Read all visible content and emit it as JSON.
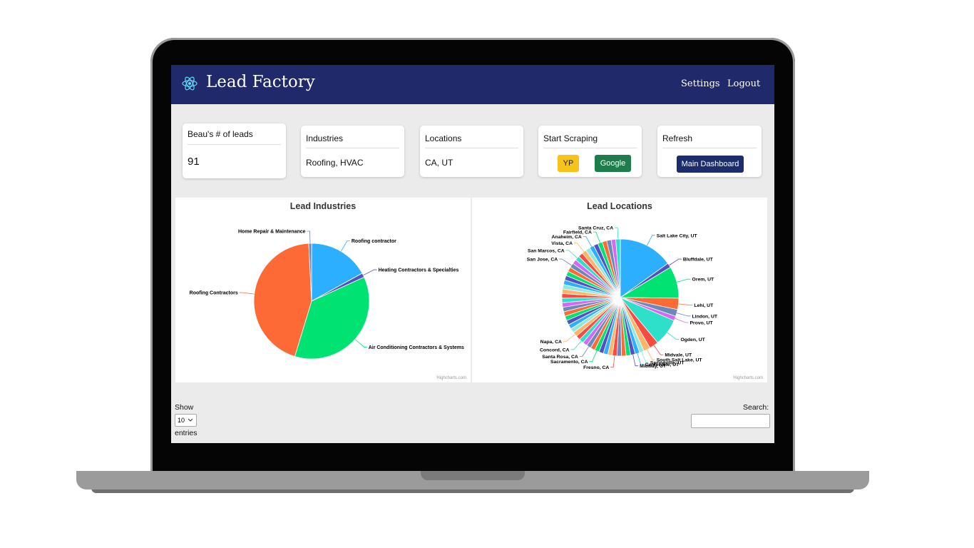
{
  "app": {
    "brand": "Lead Factory"
  },
  "nav": {
    "settings": "Settings",
    "logout": "Logout"
  },
  "cards": {
    "leads": {
      "title": "Beau's # of leads",
      "value": "91"
    },
    "industries": {
      "title": "Industries",
      "value": "Roofing, HVAC"
    },
    "locations": {
      "title": "Locations",
      "value": "CA, UT"
    },
    "scraping": {
      "title": "Start Scraping",
      "yp": "YP",
      "google": "Google"
    },
    "refresh": {
      "title": "Refresh",
      "main_dashboard": "Main Dashboard"
    }
  },
  "colors": {
    "navbar": "#202a6b",
    "yp": "#f6c21c",
    "google": "#1e7d4a",
    "dashboard": "#1d2d6b"
  },
  "credit": "Highcharts.com",
  "table_controls": {
    "show": "Show",
    "entries_value": "10",
    "entries": "entries",
    "search": "Search:"
  },
  "chart_data": [
    {
      "type": "pie",
      "title": "Lead Industries",
      "slices": [
        {
          "name": "Roofing contractor",
          "value": 17,
          "color": "#2caffe"
        },
        {
          "name": "Heating Contractors & Specialties",
          "value": 1.2,
          "color": "#544fc5"
        },
        {
          "name": "Air Conditioning Contractors & Systems",
          "value": 36.5,
          "color": "#00e272"
        },
        {
          "name": "Roofing Contractors",
          "value": 44.5,
          "color": "#fe6a35"
        },
        {
          "name": "Home Repair & Maintenance",
          "value": 0.8,
          "color": "#6b8abc"
        }
      ]
    },
    {
      "type": "pie",
      "title": "Lead Locations",
      "slices": [
        {
          "name": "Salt Lake City, UT",
          "value": 12,
          "color": "#2caffe"
        },
        {
          "name": "Bluffdale, UT",
          "value": 1,
          "color": "#544fc5"
        },
        {
          "name": "Orem, UT",
          "value": 7,
          "color": "#00e272"
        },
        {
          "name": "Lehi, UT",
          "value": 2.5,
          "color": "#fe6a35"
        },
        {
          "name": "Lindon, UT",
          "value": 1.5,
          "color": "#6b8abc"
        },
        {
          "name": "Provo, UT",
          "value": 1,
          "color": "#d568fb"
        },
        {
          "name": "Ogden, UT",
          "value": 6,
          "color": "#2ee0ca"
        },
        {
          "name": "Midvale, UT",
          "value": 2,
          "color": "#fa4b42"
        },
        {
          "name": "South Salt Lake, UT",
          "value": 1.5,
          "color": "#feb56a"
        },
        {
          "name": "Springville, UT",
          "value": 1,
          "color": "#91e8e1"
        },
        {
          "name": "Centerville, UT",
          "value": 1,
          "color": "#2caffe"
        },
        {
          "name": "Midway, UT",
          "value": 1,
          "color": "#544fc5"
        },
        {
          "name": "",
          "value": 1,
          "color": "#00e272"
        },
        {
          "name": "",
          "value": 1,
          "color": "#fe6a35"
        },
        {
          "name": "",
          "value": 1,
          "color": "#6b8abc"
        },
        {
          "name": "Fresno, CA",
          "value": 1,
          "color": "#fa4b42"
        },
        {
          "name": "",
          "value": 1,
          "color": "#feb56a"
        },
        {
          "name": "",
          "value": 1,
          "color": "#2caffe"
        },
        {
          "name": "",
          "value": 1,
          "color": "#544fc5"
        },
        {
          "name": "Sacramento, CA",
          "value": 1,
          "color": "#00e272"
        },
        {
          "name": "",
          "value": 1,
          "color": "#fe6a35"
        },
        {
          "name": "Santa Rosa, CA",
          "value": 1,
          "color": "#6b8abc"
        },
        {
          "name": "",
          "value": 1,
          "color": "#d568fb"
        },
        {
          "name": "Concord, CA",
          "value": 1,
          "color": "#2ee0ca"
        },
        {
          "name": "",
          "value": 1,
          "color": "#fa4b42"
        },
        {
          "name": "Napa, CA",
          "value": 1,
          "color": "#feb56a"
        },
        {
          "name": "",
          "value": 1,
          "color": "#91e8e1"
        },
        {
          "name": "",
          "value": 1,
          "color": "#2caffe"
        },
        {
          "name": "",
          "value": 1,
          "color": "#544fc5"
        },
        {
          "name": "",
          "value": 1,
          "color": "#00e272"
        },
        {
          "name": "",
          "value": 1,
          "color": "#fe6a35"
        },
        {
          "name": "",
          "value": 1,
          "color": "#6b8abc"
        },
        {
          "name": "",
          "value": 1,
          "color": "#d568fb"
        },
        {
          "name": "",
          "value": 1,
          "color": "#2ee0ca"
        },
        {
          "name": "",
          "value": 1,
          "color": "#fa4b42"
        },
        {
          "name": "",
          "value": 1,
          "color": "#feb56a"
        },
        {
          "name": "",
          "value": 1,
          "color": "#91e8e1"
        },
        {
          "name": "",
          "value": 1,
          "color": "#2caffe"
        },
        {
          "name": "",
          "value": 1,
          "color": "#544fc5"
        },
        {
          "name": "",
          "value": 1,
          "color": "#00e272"
        },
        {
          "name": "",
          "value": 1,
          "color": "#fe6a35"
        },
        {
          "name": "San Jose, CA",
          "value": 1,
          "color": "#6b8abc"
        },
        {
          "name": "",
          "value": 1,
          "color": "#d568fb"
        },
        {
          "name": "San Marcos, CA",
          "value": 1,
          "color": "#2ee0ca"
        },
        {
          "name": "",
          "value": 1,
          "color": "#fa4b42"
        },
        {
          "name": "Vista, CA",
          "value": 1,
          "color": "#feb56a"
        },
        {
          "name": "",
          "value": 1,
          "color": "#91e8e1"
        },
        {
          "name": "Anaheim, CA",
          "value": 1,
          "color": "#2caffe"
        },
        {
          "name": "",
          "value": 1,
          "color": "#544fc5"
        },
        {
          "name": "Fairfield, CA",
          "value": 1,
          "color": "#00e272"
        },
        {
          "name": "",
          "value": 1,
          "color": "#fe6a35"
        },
        {
          "name": "",
          "value": 1,
          "color": "#6b8abc"
        },
        {
          "name": "",
          "value": 1,
          "color": "#d568fb"
        },
        {
          "name": "Santa Cruz, CA",
          "value": 1,
          "color": "#2ee0ca"
        }
      ]
    }
  ]
}
